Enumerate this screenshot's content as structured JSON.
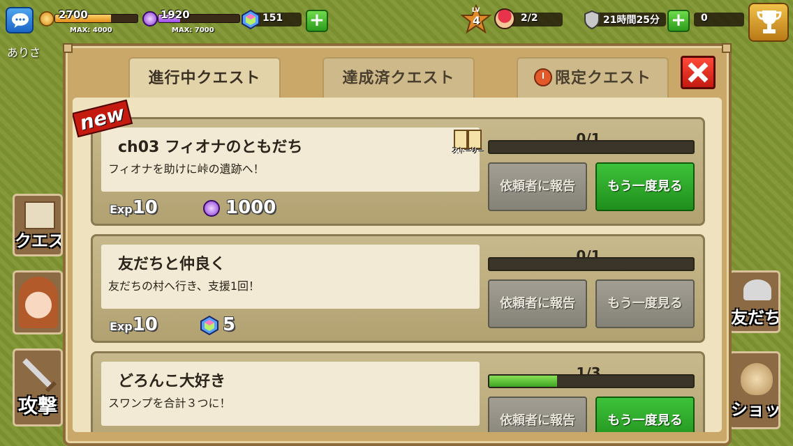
{
  "player": {
    "name": "ありさ"
  },
  "resources": {
    "gold": {
      "value": "2700",
      "max": "MAX: 4000",
      "fill": 0.68,
      "color": "#f6b23a"
    },
    "elixir": {
      "value": "1920",
      "max": "MAX: 7000",
      "fill": 0.27,
      "color": "#c483ff"
    },
    "gems": {
      "value": "151"
    },
    "units": {
      "value": "2/2"
    },
    "shield": {
      "value": "21時間25分"
    },
    "trophies": {
      "value": "0"
    }
  },
  "level": {
    "label": "LV",
    "value": "4"
  },
  "side_buttons": {
    "quest": "クエスト",
    "attack": "攻撃",
    "friends": "友だち",
    "shop": "ショップ"
  },
  "tabs": {
    "in_progress": "進行中クエスト",
    "completed": "達成済クエスト",
    "limited": "限定クエスト"
  },
  "badge_new": "new",
  "story_icon_label": "ストーリー",
  "quests": [
    {
      "title": "ch03 フィオナのともだち",
      "desc": "フィオナを助けに峠の遺跡へ！",
      "exp_label": "Exp",
      "exp": "10",
      "reward": "1000",
      "reward_icon": "elixir-icon",
      "progress_text": "0/1",
      "progress": 0.0,
      "report_btn": "依頼者に報告",
      "replay_btn": "もう一度見る",
      "replay_active": true
    },
    {
      "title": "友だちと仲良く",
      "desc": "友だちの村へ行き、支援1回！",
      "exp_label": "Exp",
      "exp": "10",
      "reward": "5",
      "reward_icon": "gem-icon",
      "progress_text": "0/1",
      "progress": 0.0,
      "report_btn": "依頼者に報告",
      "replay_btn": "もう一度見る",
      "replay_active": false
    },
    {
      "title": "どろんこ大好き",
      "desc": "スワンプを合計３つに！",
      "progress_text": "1/3",
      "progress": 0.333,
      "report_btn": "依頼者に報告",
      "replay_btn": "もう一度見る",
      "replay_active": true
    }
  ]
}
